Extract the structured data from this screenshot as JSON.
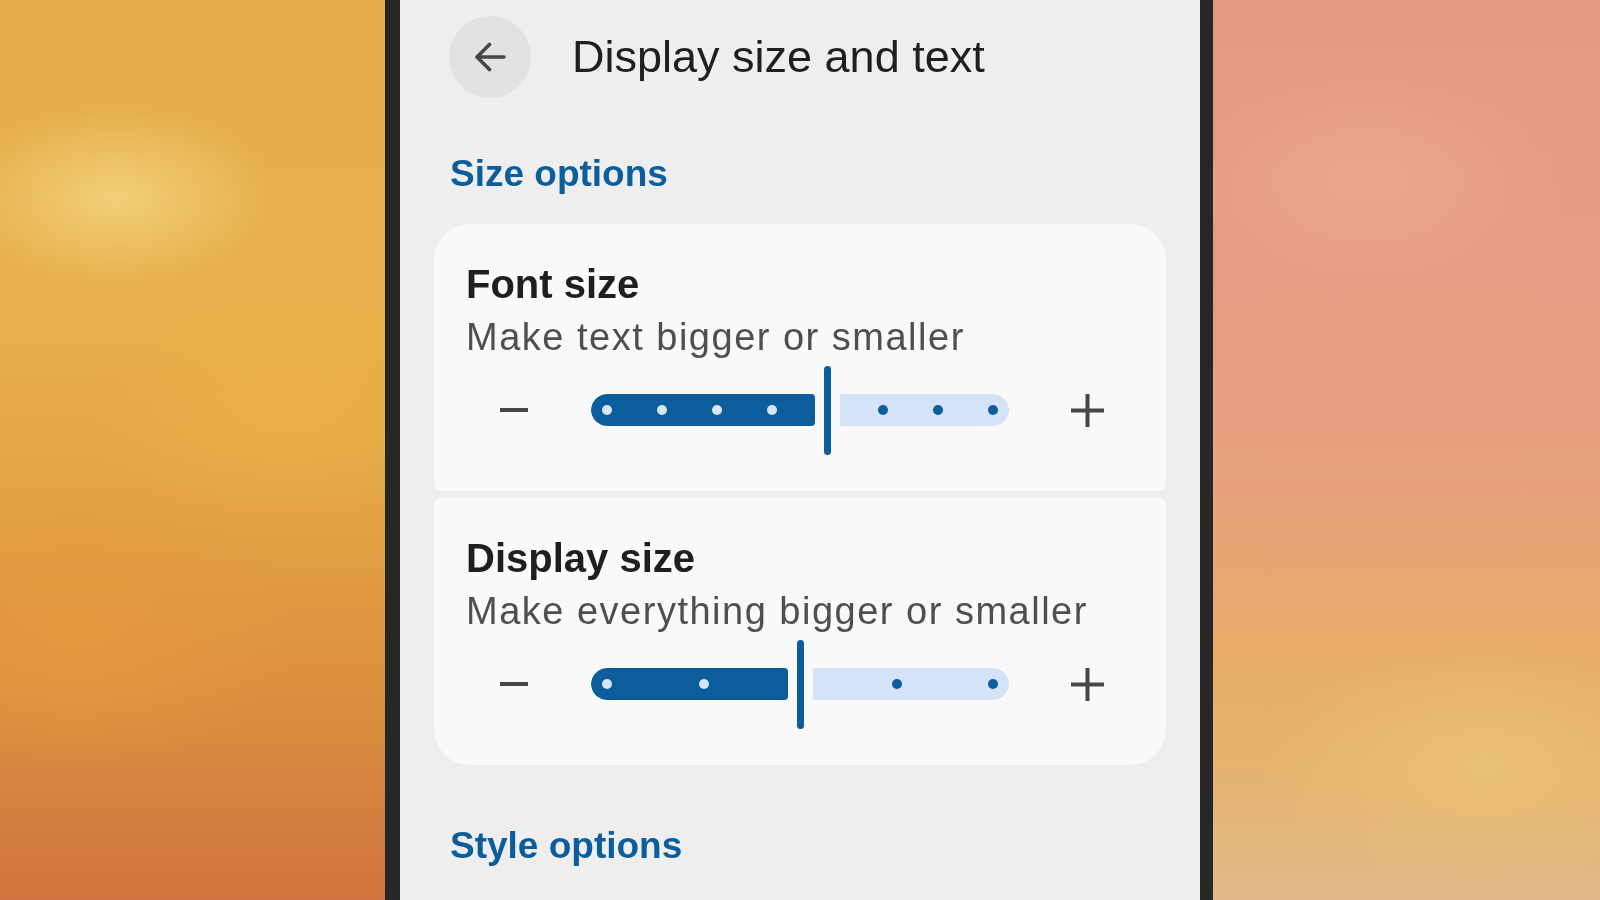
{
  "header": {
    "title": "Display size and text"
  },
  "sections": [
    {
      "heading": "Size options",
      "cards": [
        {
          "title": "Font size",
          "subtitle": "Make text bigger or smaller",
          "slider": {
            "level": 0.571,
            "stops": [
              {
                "selected": false
              },
              {
                "selected": false
              },
              {
                "selected": false
              },
              {
                "selected": false
              },
              {
                "selected": true
              },
              {
                "selected": false
              },
              {
                "selected": false
              },
              {
                "selected": false
              }
            ]
          }
        },
        {
          "title": "Display size",
          "subtitle": "Make everything bigger or smaller",
          "slider": {
            "level": 0.5,
            "stops": [
              {
                "selected": false
              },
              {
                "selected": false
              },
              {
                "selected": true
              },
              {
                "selected": false
              },
              {
                "selected": false
              }
            ]
          }
        }
      ]
    },
    {
      "heading": "Style options"
    }
  ]
}
